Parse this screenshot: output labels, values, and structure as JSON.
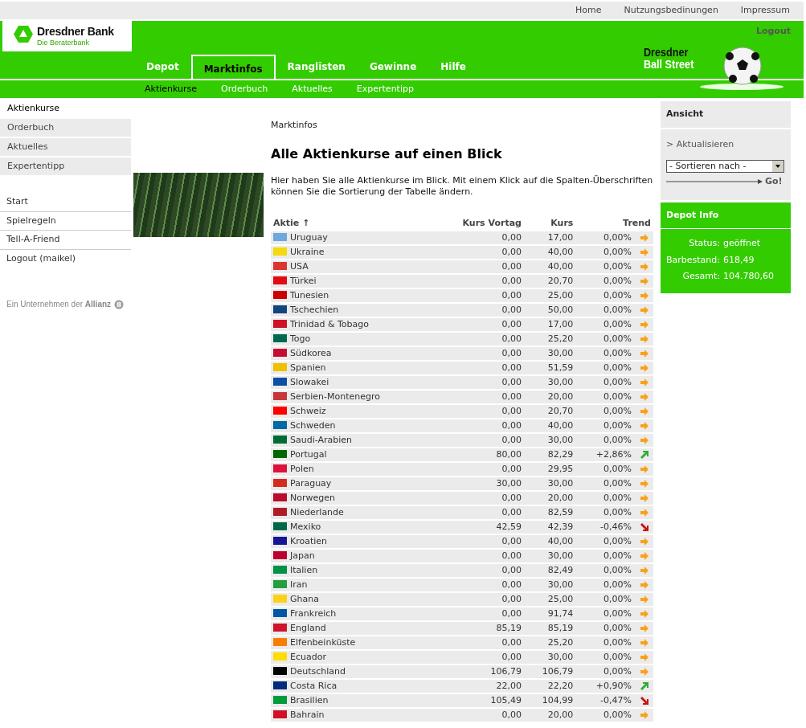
{
  "top_links": [
    "Home",
    "Nutzungsbedinungen",
    "Impressum"
  ],
  "logo": {
    "name": "Dresdner Bank",
    "tagline": "Die Beraterbank"
  },
  "logout": "Logout",
  "brand": {
    "line_1": "Dresdner",
    "line_2": "Ball Street"
  },
  "tabs": [
    {
      "label": "Depot",
      "selected": false
    },
    {
      "label": "Marktinfos",
      "selected": true
    },
    {
      "label": "Ranglisten",
      "selected": false
    },
    {
      "label": "Gewinne",
      "selected": false
    },
    {
      "label": "Hilfe",
      "selected": false
    }
  ],
  "subtabs": [
    {
      "label": "Aktienkurse",
      "selected": true
    },
    {
      "label": "Orderbuch",
      "selected": false
    },
    {
      "label": "Aktuelles",
      "selected": false
    },
    {
      "label": "Expertentipp",
      "selected": false
    }
  ],
  "sidebar": {
    "items": [
      {
        "label": "Aktienkurse",
        "selected": true
      },
      {
        "label": "Orderbuch",
        "selected": false
      },
      {
        "label": "Aktuelles",
        "selected": false
      },
      {
        "label": "Expertentipp",
        "selected": false
      }
    ],
    "links": [
      "Start",
      "Spielregeln",
      "Tell-A-Friend",
      "Logout (maikel)"
    ],
    "footer": "Ein Unternehmen der **Allianz**"
  },
  "breadcrumb": "Marktinfos",
  "heading": "Alle Aktienkurse auf einen Blick",
  "intro": "Hier haben Sie alle Aktienkurse im Blick. Mit einem Klick auf die Spalten-Überschriften können Sie die Sortierung der Tabelle ändern.",
  "table": {
    "columns": [
      "Aktie",
      "Kurs Vortag",
      "Kurs",
      "Trend"
    ],
    "sort_mark": "↑",
    "rows": [
      {
        "name": "Uruguay",
        "color": "#6fa8dc",
        "prev": "0,00",
        "price": "17,00",
        "trend": "0,00%",
        "kind": "flat"
      },
      {
        "name": "Ukraine",
        "color": "#f5d90a",
        "prev": "0,00",
        "price": "40,00",
        "trend": "0,00%",
        "kind": "flat"
      },
      {
        "name": "USA",
        "color": "#dd3333",
        "prev": "0,00",
        "price": "40,00",
        "trend": "0,00%",
        "kind": "flat"
      },
      {
        "name": "Türkei",
        "color": "#e30a17",
        "prev": "0,00",
        "price": "20,70",
        "trend": "0,00%",
        "kind": "flat"
      },
      {
        "name": "Tunesien",
        "color": "#cc0000",
        "prev": "0,00",
        "price": "25,00",
        "trend": "0,00%",
        "kind": "flat"
      },
      {
        "name": "Tschechien",
        "color": "#11457e",
        "prev": "0,00",
        "price": "50,00",
        "trend": "0,00%",
        "kind": "flat"
      },
      {
        "name": "Trinidad & Tobago",
        "color": "#ce1126",
        "prev": "0,00",
        "price": "17,00",
        "trend": "0,00%",
        "kind": "flat"
      },
      {
        "name": "Togo",
        "color": "#006a4e",
        "prev": "0,00",
        "price": "25,20",
        "trend": "0,00%",
        "kind": "flat"
      },
      {
        "name": "Südkorea",
        "color": "#c60c30",
        "prev": "0,00",
        "price": "30,00",
        "trend": "0,00%",
        "kind": "flat"
      },
      {
        "name": "Spanien",
        "color": "#f1bf00",
        "prev": "0,00",
        "price": "51,59",
        "trend": "0,00%",
        "kind": "flat"
      },
      {
        "name": "Slowakei",
        "color": "#0b4ea2",
        "prev": "0,00",
        "price": "30,00",
        "trend": "0,00%",
        "kind": "flat"
      },
      {
        "name": "Serbien-Montenegro",
        "color": "#c6363c",
        "prev": "0,00",
        "price": "20,00",
        "trend": "0,00%",
        "kind": "flat"
      },
      {
        "name": "Schweiz",
        "color": "#ff0000",
        "prev": "0,00",
        "price": "20,70",
        "trend": "0,00%",
        "kind": "flat"
      },
      {
        "name": "Schweden",
        "color": "#006aa7",
        "prev": "0,00",
        "price": "40,00",
        "trend": "0,00%",
        "kind": "flat"
      },
      {
        "name": "Saudi-Arabien",
        "color": "#006c35",
        "prev": "0,00",
        "price": "30,00",
        "trend": "0,00%",
        "kind": "flat"
      },
      {
        "name": "Portugal",
        "color": "#006600",
        "prev": "80,00",
        "price": "82,29",
        "trend": "+2,86%",
        "kind": "up"
      },
      {
        "name": "Polen",
        "color": "#dc143c",
        "prev": "0,00",
        "price": "29,95",
        "trend": "0,00%",
        "kind": "flat"
      },
      {
        "name": "Paraguay",
        "color": "#d52b1e",
        "prev": "30,00",
        "price": "30,00",
        "trend": "0,00%",
        "kind": "flat"
      },
      {
        "name": "Norwegen",
        "color": "#ba0c2f",
        "prev": "0,00",
        "price": "20,00",
        "trend": "0,00%",
        "kind": "flat"
      },
      {
        "name": "Niederlande",
        "color": "#ae1c28",
        "prev": "0,00",
        "price": "82,59",
        "trend": "0,00%",
        "kind": "flat"
      },
      {
        "name": "Mexiko",
        "color": "#006847",
        "prev": "42,59",
        "price": "42,39",
        "trend": "-0,46%",
        "kind": "down"
      },
      {
        "name": "Kroatien",
        "color": "#171796",
        "prev": "0,00",
        "price": "40,00",
        "trend": "0,00%",
        "kind": "flat"
      },
      {
        "name": "Japan",
        "color": "#bc002d",
        "prev": "0,00",
        "price": "30,00",
        "trend": "0,00%",
        "kind": "flat"
      },
      {
        "name": "Italien",
        "color": "#009246",
        "prev": "0,00",
        "price": "82,49",
        "trend": "0,00%",
        "kind": "flat"
      },
      {
        "name": "Iran",
        "color": "#239f40",
        "prev": "0,00",
        "price": "30,00",
        "trend": "0,00%",
        "kind": "flat"
      },
      {
        "name": "Ghana",
        "color": "#fcd116",
        "prev": "0,00",
        "price": "25,00",
        "trend": "0,00%",
        "kind": "flat"
      },
      {
        "name": "Frankreich",
        "color": "#0055a4",
        "prev": "0,00",
        "price": "91,74",
        "trend": "0,00%",
        "kind": "flat"
      },
      {
        "name": "England",
        "color": "#cf142b",
        "prev": "85,19",
        "price": "85,19",
        "trend": "0,00%",
        "kind": "flat"
      },
      {
        "name": "Elfenbeinküste",
        "color": "#f77f00",
        "prev": "0,00",
        "price": "25,20",
        "trend": "0,00%",
        "kind": "flat"
      },
      {
        "name": "Ecuador",
        "color": "#ffdd00",
        "prev": "0,00",
        "price": "30,00",
        "trend": "0,00%",
        "kind": "flat"
      },
      {
        "name": "Deutschland",
        "color": "#000000",
        "prev": "106,79",
        "price": "106,79",
        "trend": "0,00%",
        "kind": "flat"
      },
      {
        "name": "Costa Rica",
        "color": "#002b7f",
        "prev": "22,00",
        "price": "22,20",
        "trend": "+0,90%",
        "kind": "up"
      },
      {
        "name": "Brasilien",
        "color": "#009c3b",
        "prev": "105,49",
        "price": "104,99",
        "trend": "-0,47%",
        "kind": "down"
      },
      {
        "name": "Bahrain",
        "color": "#ce1126",
        "prev": "0,00",
        "price": "20,00",
        "trend": "0,00%",
        "kind": "flat"
      }
    ]
  },
  "view_panel": {
    "title": "Ansicht",
    "refresh": "> Aktualisieren",
    "sort_select": "- Sortieren nach -",
    "go": "Go!"
  },
  "depot_info": {
    "title": "Depot Info",
    "rows": [
      {
        "label": "Status:",
        "value": "geöffnet"
      },
      {
        "label": "Barbestand:",
        "value": "618,49"
      },
      {
        "label": "Gesamt:",
        "value": "104.780,60"
      }
    ]
  }
}
